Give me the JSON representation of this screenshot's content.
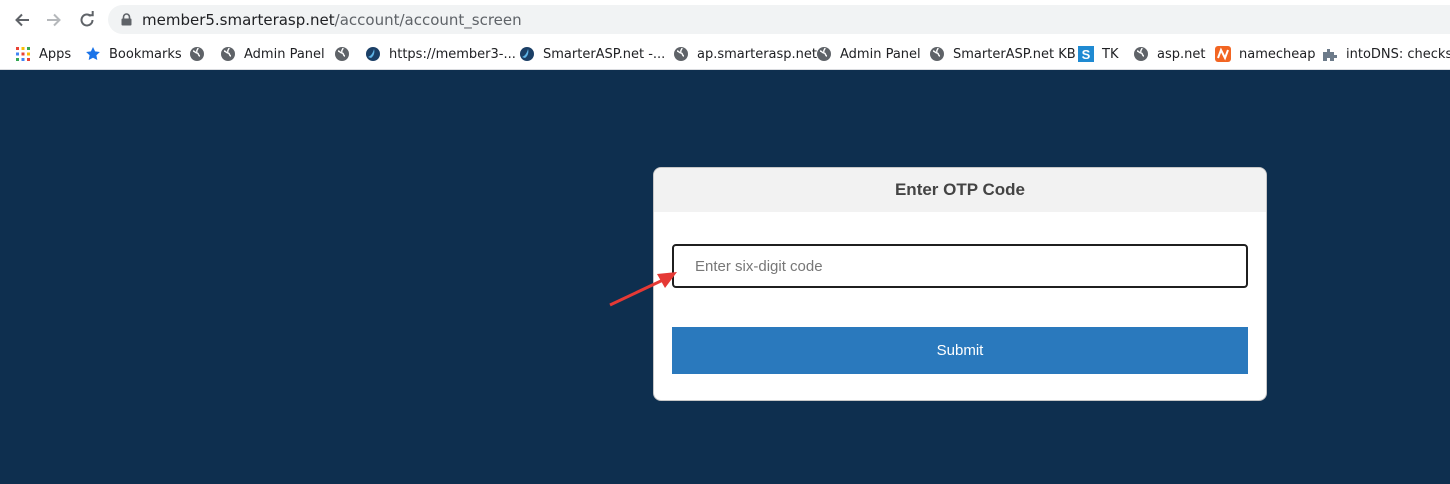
{
  "browser": {
    "url_host": "member5.smarterasp.net",
    "url_path": "/account/account_screen"
  },
  "bookmarks": [
    {
      "label": "Apps",
      "icon": "apps-grid-icon"
    },
    {
      "label": "Bookmarks",
      "icon": "star-icon"
    },
    {
      "label": "",
      "icon": "globe-icon"
    },
    {
      "label": "Admin Panel",
      "icon": "globe-icon"
    },
    {
      "label": "",
      "icon": "globe-icon"
    },
    {
      "label": "https://member3-...",
      "icon": "smarterasp-icon"
    },
    {
      "label": "SmarterASP.net -...",
      "icon": "smarterasp-icon"
    },
    {
      "label": "ap.smarterasp.net",
      "icon": "globe-icon"
    },
    {
      "label": "Admin Panel",
      "icon": "globe-icon"
    },
    {
      "label": "SmarterASP.net KB",
      "icon": "globe-icon"
    },
    {
      "label": "TK",
      "icon": "s-icon"
    },
    {
      "label": "asp.net",
      "icon": "globe-icon"
    },
    {
      "label": "namecheap",
      "icon": "namecheap-icon"
    },
    {
      "label": "intoDNS: checks...",
      "icon": "puzzle-icon"
    }
  ],
  "card": {
    "title": "Enter OTP Code",
    "input_placeholder": "Enter six-digit code",
    "input_value": "",
    "submit_label": "Submit"
  },
  "colors": {
    "background": "#0e2f4f",
    "submit": "#2a79bd",
    "annotation_arrow": "#e53935"
  }
}
